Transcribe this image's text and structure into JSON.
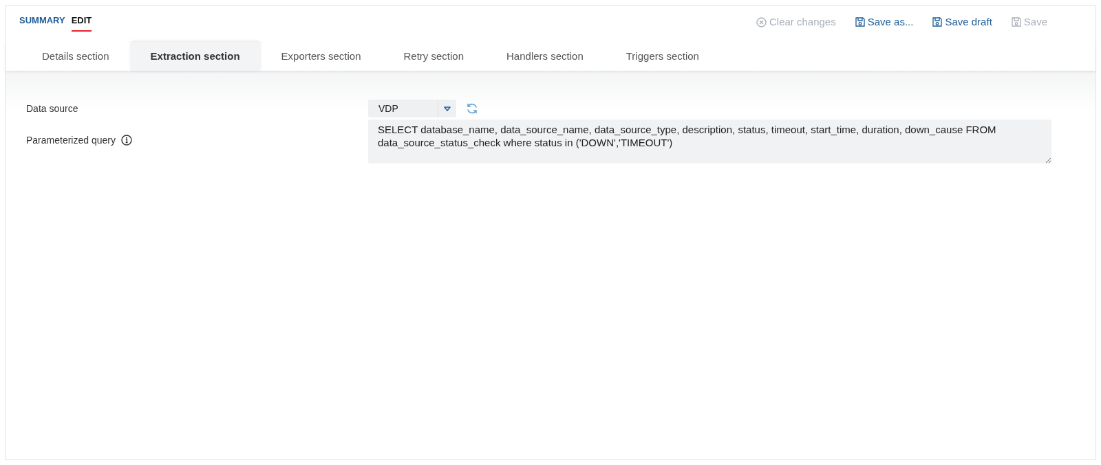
{
  "nav": [
    {
      "label": "SUMMARY",
      "selected": false
    },
    {
      "label": "EDIT",
      "selected": true
    }
  ],
  "actions": [
    {
      "kind": "clear",
      "label": "Clear changes",
      "disabled": true
    },
    {
      "kind": "save",
      "label": "Save as...",
      "disabled": false
    },
    {
      "kind": "save",
      "label": "Save draft",
      "disabled": false
    },
    {
      "kind": "save",
      "label": "Save",
      "disabled": true
    }
  ],
  "tabs": [
    {
      "label": "Details section",
      "selected": false
    },
    {
      "label": "Extraction section",
      "selected": true
    },
    {
      "label": "Exporters section",
      "selected": false
    },
    {
      "label": "Retry section",
      "selected": false
    },
    {
      "label": "Handlers section",
      "selected": false
    },
    {
      "label": "Triggers section",
      "selected": false
    }
  ],
  "form": {
    "data_source": {
      "label": "Data source",
      "value": "VDP"
    },
    "query": {
      "label": "Parameterized query",
      "value": "SELECT database_name, data_source_name, data_source_type, description, status, timeout, start_time, duration, down_cause FROM data_source_status_check where status in ('DOWN','TIMEOUT')"
    }
  }
}
